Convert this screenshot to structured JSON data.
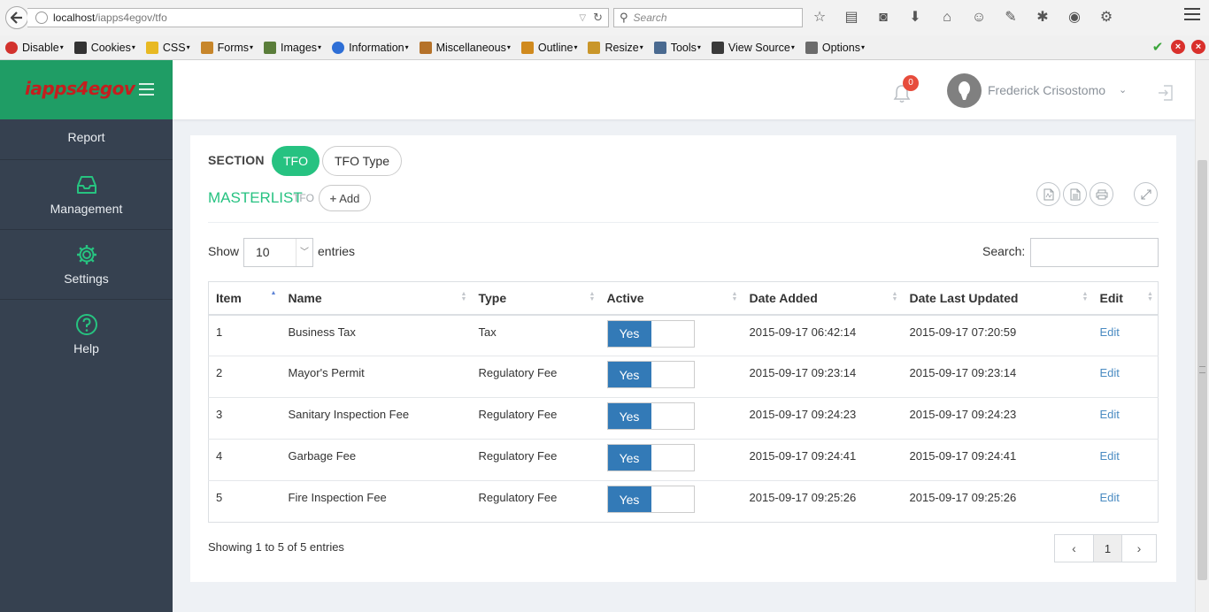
{
  "browser": {
    "url_host": "localhost",
    "url_path": "/iapps4egov/tfo",
    "search_placeholder": "Search",
    "devbar": [
      {
        "label": "Disable",
        "color": "#d2322d"
      },
      {
        "label": "Cookies",
        "color": "#333333"
      },
      {
        "label": "CSS",
        "color": "#e8b923"
      },
      {
        "label": "Forms",
        "color": "#c7862b"
      },
      {
        "label": "Images",
        "color": "#5a7d3a"
      },
      {
        "label": "Information",
        "color": "#2e6fd6"
      },
      {
        "label": "Miscellaneous",
        "color": "#b5722a"
      },
      {
        "label": "Outline",
        "color": "#d08a1e"
      },
      {
        "label": "Resize",
        "color": "#c9962a"
      },
      {
        "label": "Tools",
        "color": "#4a6a90"
      },
      {
        "label": "View Source",
        "color": "#3a3a3a"
      },
      {
        "label": "Options",
        "color": "#6b6b6b"
      }
    ]
  },
  "app": {
    "logo_text": "iapps4egov",
    "sidebar": [
      {
        "label": "Report",
        "icon": "report-icon"
      },
      {
        "label": "Management",
        "icon": "inbox-icon"
      },
      {
        "label": "Settings",
        "icon": "gear-icon"
      },
      {
        "label": "Help",
        "icon": "question-icon"
      }
    ],
    "notifications_count": "0",
    "user_name": "Frederick Crisostomo",
    "accent": "#26c281",
    "brand": "#1f9d65"
  },
  "section": {
    "label": "SECTION",
    "tabs": [
      {
        "label": "TFO",
        "active": true
      },
      {
        "label": "TFO Type",
        "active": false
      }
    ]
  },
  "masterlist": {
    "title": "MASTERLIST",
    "subtitle": "TFO",
    "add_label": "Add"
  },
  "table_controls": {
    "show_label": "Show",
    "page_size": "10",
    "entries_label": "entries",
    "search_label": "Search:"
  },
  "table": {
    "columns": [
      "Item",
      "Name",
      "Type",
      "Active",
      "Date Added",
      "Date Last Updated",
      "Edit"
    ],
    "rows": [
      {
        "item": "1",
        "name": "Business Tax",
        "type": "Tax",
        "active": "Yes",
        "date_added": "2015-09-17 06:42:14",
        "date_updated": "2015-09-17 07:20:59",
        "edit": "Edit"
      },
      {
        "item": "2",
        "name": "Mayor's Permit",
        "type": "Regulatory Fee",
        "active": "Yes",
        "date_added": "2015-09-17 09:23:14",
        "date_updated": "2015-09-17 09:23:14",
        "edit": "Edit"
      },
      {
        "item": "3",
        "name": "Sanitary Inspection Fee",
        "type": "Regulatory Fee",
        "active": "Yes",
        "date_added": "2015-09-17 09:24:23",
        "date_updated": "2015-09-17 09:24:23",
        "edit": "Edit"
      },
      {
        "item": "4",
        "name": "Garbage Fee",
        "type": "Regulatory Fee",
        "active": "Yes",
        "date_added": "2015-09-17 09:24:41",
        "date_updated": "2015-09-17 09:24:41",
        "edit": "Edit"
      },
      {
        "item": "5",
        "name": "Fire Inspection Fee",
        "type": "Regulatory Fee",
        "active": "Yes",
        "date_added": "2015-09-17 09:25:26",
        "date_updated": "2015-09-17 09:25:26",
        "edit": "Edit"
      }
    ]
  },
  "footer": {
    "info": "Showing 1 to 5 of 5 entries",
    "prev": "‹",
    "page": "1",
    "next": "›"
  }
}
